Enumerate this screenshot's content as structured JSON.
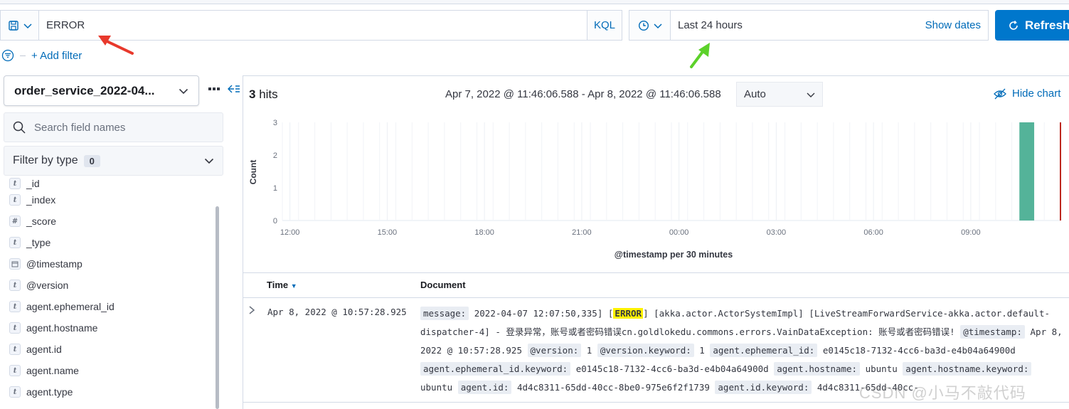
{
  "query": {
    "value": "ERROR",
    "language": "KQL"
  },
  "date_picker": {
    "range": "Last 24 hours",
    "show_dates": "Show dates",
    "refresh": "Refresh"
  },
  "filters": {
    "add_filter": "+ Add filter"
  },
  "sidebar": {
    "index_pattern": "order_service_2022-04...",
    "search_placeholder": "Search field names",
    "filter_by_type": "Filter by type",
    "filter_count": "0",
    "fields": [
      {
        "type": "t",
        "name": "_id"
      },
      {
        "type": "t",
        "name": "_index"
      },
      {
        "type": "#",
        "name": "_score"
      },
      {
        "type": "t",
        "name": "_type"
      },
      {
        "type": "date",
        "name": "@timestamp"
      },
      {
        "type": "t",
        "name": "@version"
      },
      {
        "type": "t",
        "name": "agent.ephemeral_id"
      },
      {
        "type": "t",
        "name": "agent.hostname"
      },
      {
        "type": "t",
        "name": "agent.id"
      },
      {
        "type": "t",
        "name": "agent.name"
      },
      {
        "type": "t",
        "name": "agent.type"
      }
    ]
  },
  "results": {
    "hits_count": "3",
    "hits_label": "hits",
    "time_range": "Apr 7, 2022 @ 11:46:06.588 - Apr 8, 2022 @ 11:46:06.588",
    "interval": "Auto",
    "hide_chart": "Hide chart"
  },
  "chart_data": {
    "type": "bar",
    "ylabel": "Count",
    "xlabel": "@timestamp per 30 minutes",
    "ylim": [
      0,
      3
    ],
    "y_ticks": [
      "0",
      "1",
      "2",
      "3"
    ],
    "x_ticks": [
      "12:00",
      "15:00",
      "18:00",
      "21:00",
      "00:00",
      "03:00",
      "06:00",
      "09:00"
    ],
    "bars": [
      {
        "x": "10:30",
        "value": 3
      }
    ],
    "bar_color": "#54b399",
    "now_marker_color": "#bd271e"
  },
  "table": {
    "col_time": "Time",
    "col_document": "Document",
    "rows": [
      {
        "time": "Apr 8, 2022 @ 10:57:28.925",
        "doc": {
          "k_message": "message:",
          "v_message_pre": " 2022-04-07 12:07:50,335] [",
          "v_message_hl": "ERROR",
          "v_message_post": "] [akka.actor.ActorSystemImpl] [LiveStreamForwardService-akka.actor.default-dispatcher-4] - 登录异常，账号或者密码错误cn.goldlokedu.commons.errors.VainDataException: 账号或者密码错误! ",
          "k_timestamp": "@timestamp:",
          "v_timestamp": " Apr 8, 2022 @ 10:57:28.925 ",
          "k_version": "@version:",
          "v_version": " 1 ",
          "k_version_kw": "@version.keyword:",
          "v_version_kw": " 1 ",
          "k_eph": "agent.ephemeral_id:",
          "v_eph": " e0145c18-7132-4cc6-ba3d-e4b04a64900d ",
          "k_eph_kw": "agent.ephemeral_id.keyword:",
          "v_eph_kw": " e0145c18-7132-4cc6-ba3d-e4b04a64900d ",
          "k_host": "agent.hostname:",
          "v_host": " ubuntu ",
          "k_host_kw": "agent.hostname.keyword:",
          "v_host_kw": " ubuntu ",
          "k_id": "agent.id:",
          "v_id": " 4d4c8311-65dd-40cc-8be0-975e6f2f1739 ",
          "k_id_kw": "agent.id.keyword:",
          "v_id_kw": " 4d4c8311-65dd-40cc-"
        }
      }
    ]
  },
  "watermark": "CSDN @小马不敲代码"
}
